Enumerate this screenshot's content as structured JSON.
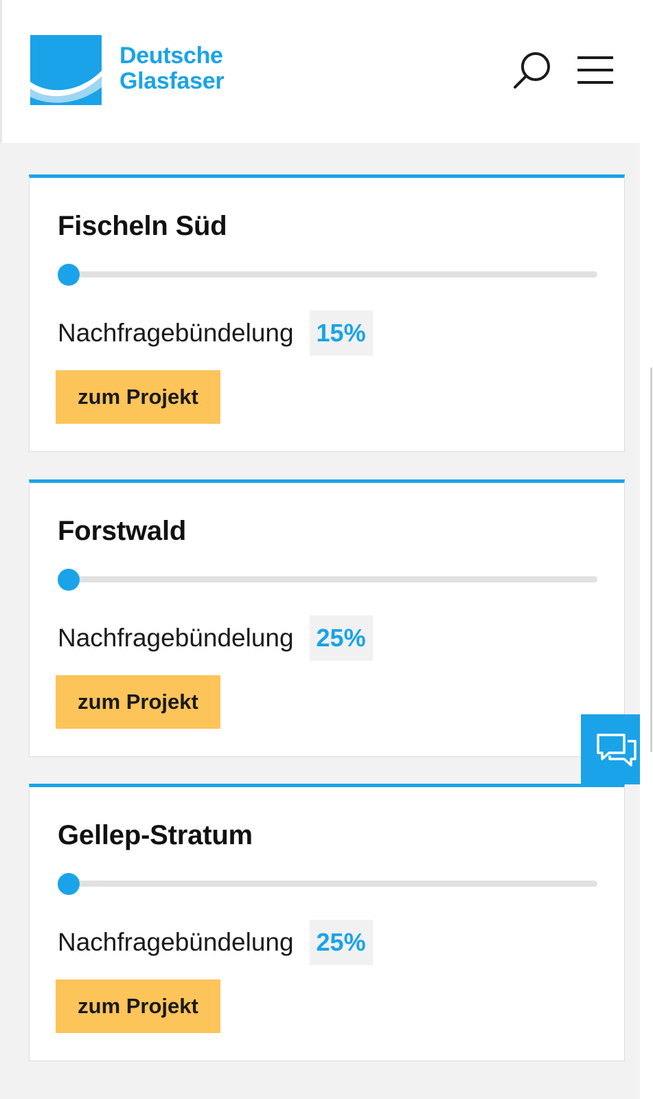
{
  "brand": {
    "name_line1": "Deutsche",
    "name_line2": "Glasfaser",
    "color": "#1aa3e8"
  },
  "header": {
    "search_icon": "search-icon",
    "menu_icon": "hamburger-menu-icon"
  },
  "projects": [
    {
      "title": "Fischeln Süd",
      "status_label": "Nachfragebündelung",
      "percent_text": "15%",
      "progress": 0,
      "button_label": "zum Projekt"
    },
    {
      "title": "Forstwald",
      "status_label": "Nachfragebündelung",
      "percent_text": "25%",
      "progress": 0,
      "button_label": "zum Projekt"
    },
    {
      "title": "Gellep-Stratum",
      "status_label": "Nachfragebündelung",
      "percent_text": "25%",
      "progress": 0,
      "button_label": "zum Projekt"
    }
  ],
  "chat": {
    "icon": "chat-bubbles-icon"
  },
  "colors": {
    "accent": "#1aa3e8",
    "button": "#fdc45a",
    "track": "#e1e1e1",
    "page_background": "#f2f2f2"
  }
}
